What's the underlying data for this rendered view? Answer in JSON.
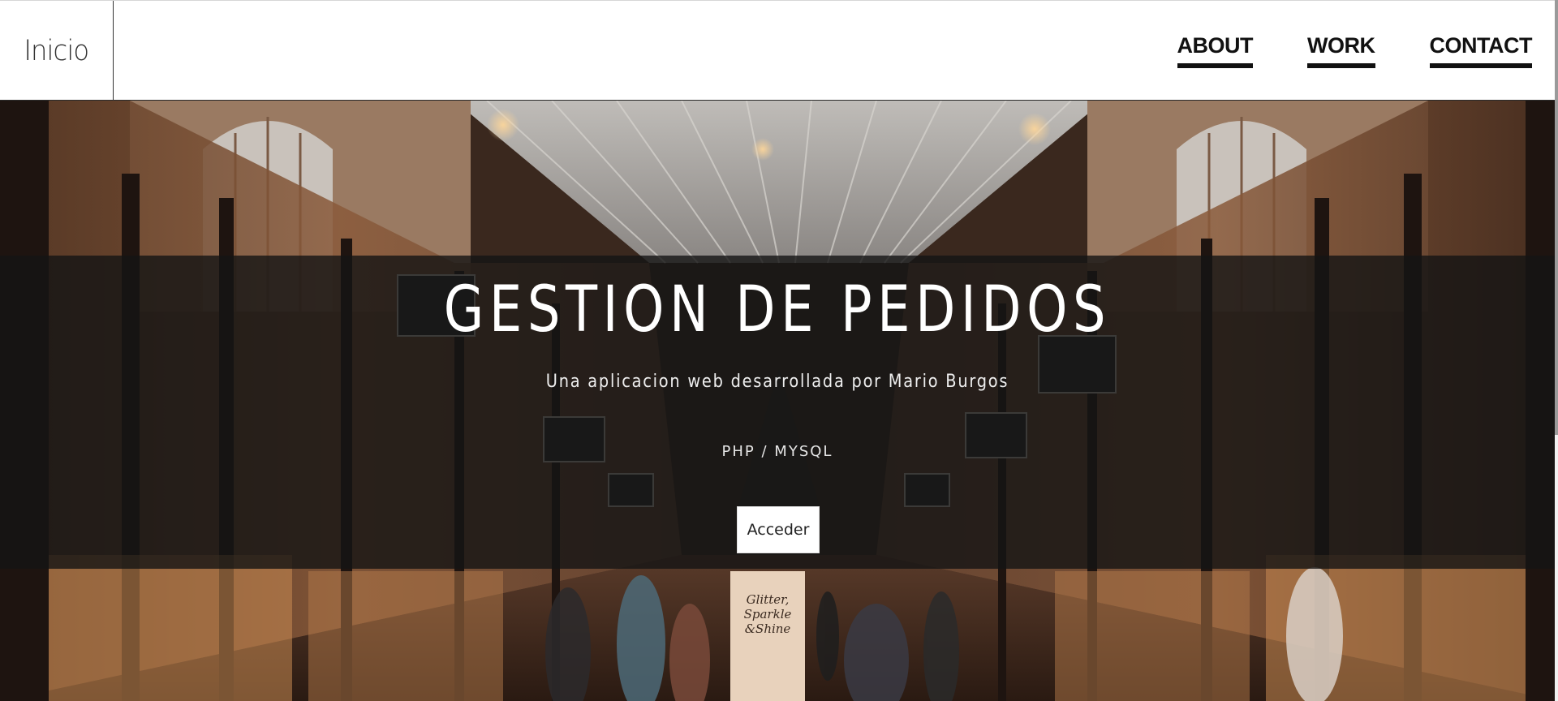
{
  "header": {
    "brand": "Inicio",
    "nav": [
      {
        "label": "ABOUT"
      },
      {
        "label": "WORK"
      },
      {
        "label": "CONTACT"
      }
    ]
  },
  "hero": {
    "title": "GESTION DE PEDIDOS",
    "subtitle": "Una aplicacion web desarrollada por Mario Burgos",
    "tech": "PHP / MYSQL",
    "cta_label": "Acceder",
    "background": "shopping-arcade-photo",
    "overlay_color": "#141414"
  },
  "colors": {
    "header_bg": "#ffffff",
    "nav_text": "#111111",
    "hero_text": "#ffffff",
    "button_bg": "#ffffff"
  }
}
